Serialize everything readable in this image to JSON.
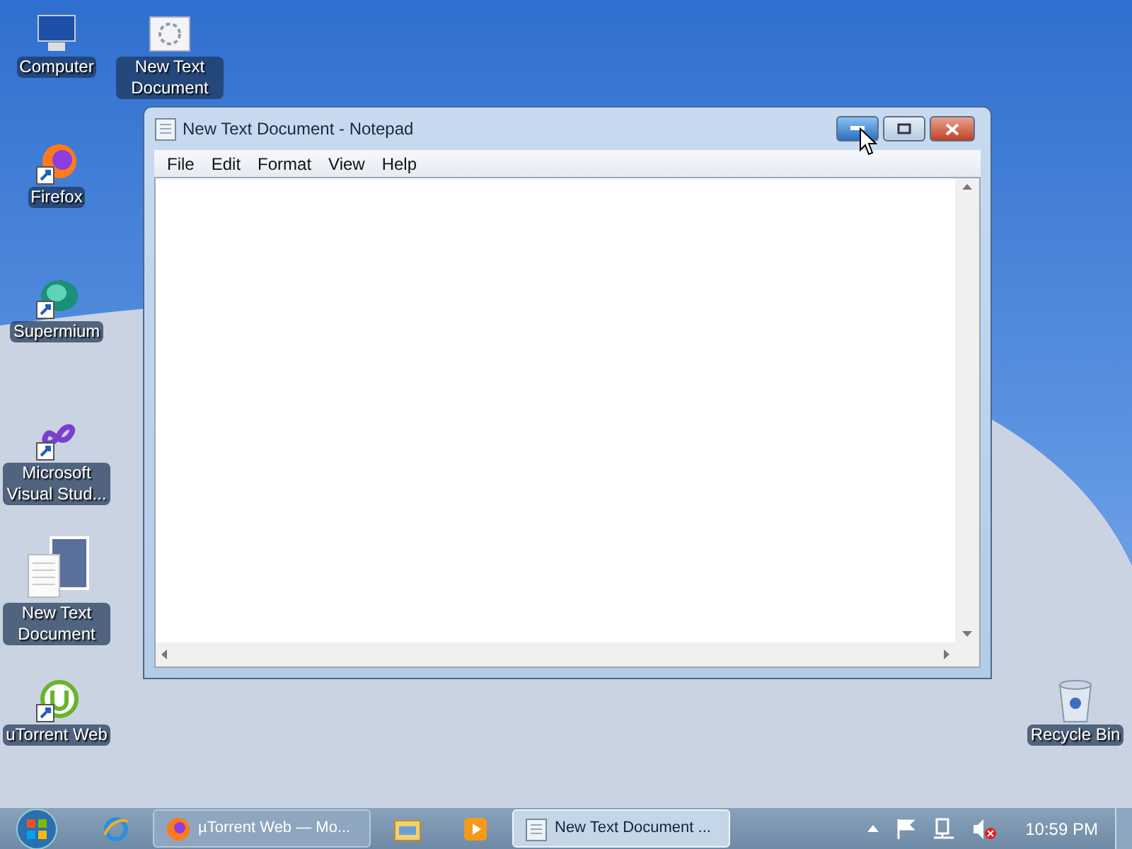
{
  "desktop_icons": [
    {
      "label": "Computer",
      "kind": "computer"
    },
    {
      "label": "New Text Document",
      "kind": "gear-doc"
    },
    {
      "label": "Firefox",
      "kind": "firefox"
    },
    {
      "label": "Supermium",
      "kind": "supermium"
    },
    {
      "label": "Microsoft Visual Stud...",
      "kind": "vs"
    },
    {
      "label": "New Text Document",
      "kind": "notes"
    },
    {
      "label": "uTorrent Web",
      "kind": "utorrent"
    },
    {
      "label": "Recycle Bin",
      "kind": "recycle"
    }
  ],
  "window": {
    "title": "New Text Document - Notepad",
    "menu": [
      "File",
      "Edit",
      "Format",
      "View",
      "Help"
    ],
    "controls": [
      {
        "kind": "minimize",
        "hovered": true
      },
      {
        "kind": "maximize",
        "hovered": false
      },
      {
        "kind": "close",
        "hovered": false
      }
    ]
  },
  "taskbar": {
    "items": [
      {
        "kind": "ie",
        "selected": false
      },
      {
        "kind": "firefox",
        "label": "µTorrent Web — Mo...",
        "selected": false
      },
      {
        "kind": "explorer",
        "selected": false
      },
      {
        "kind": "media",
        "selected": false
      },
      {
        "kind": "notepad",
        "label": "New Text Document ...",
        "selected": true
      }
    ],
    "clock": "10:59 PM"
  }
}
